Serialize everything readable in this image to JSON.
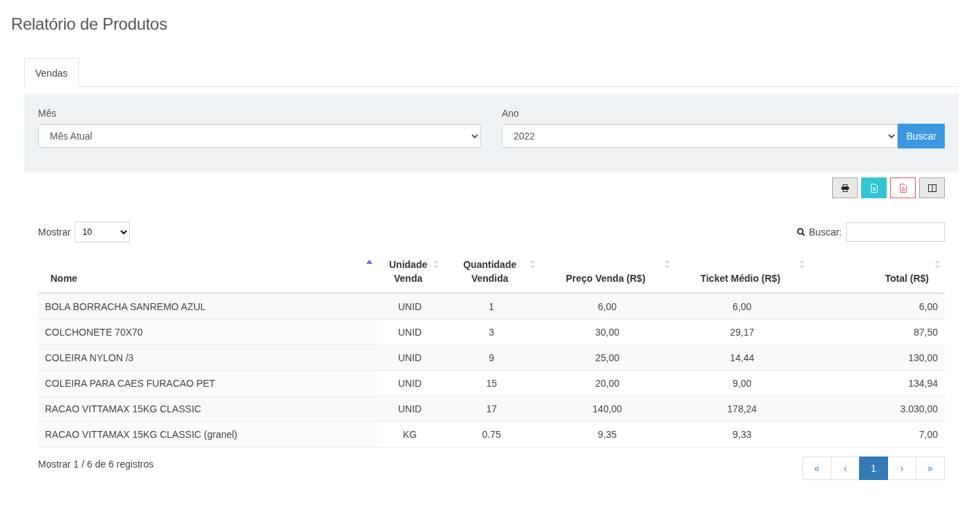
{
  "page_title": "Relatório de Produtos",
  "tabs": [
    {
      "label": "Vendas",
      "selected": true
    }
  ],
  "filters": {
    "month": {
      "label": "Mês",
      "value": "Mês Atual"
    },
    "year": {
      "label": "Ano",
      "value": "2022"
    },
    "search_button": "Buscar"
  },
  "toolbar": [
    {
      "kind": "print"
    },
    {
      "kind": "excel"
    },
    {
      "kind": "pdf"
    },
    {
      "kind": "columns"
    }
  ],
  "length": {
    "label": "Mostrar",
    "value": "10"
  },
  "search": {
    "label": "Buscar:"
  },
  "table": {
    "columns": [
      {
        "label": "Nome",
        "sorted": true
      },
      {
        "label": "Unidade Venda",
        "sorted": false
      },
      {
        "label": "Quantidade Vendida",
        "sorted": false
      },
      {
        "label": "Preço Venda (R$)",
        "sorted": false
      },
      {
        "label": "Ticket Médio (R$)",
        "sorted": false
      },
      {
        "label": "Total (R$)",
        "sorted": false
      }
    ],
    "rows": [
      [
        "BOLA BORRACHA SANREMO AZUL",
        "UNID",
        "1",
        "6,00",
        "6,00",
        "6,00"
      ],
      [
        "COLCHONETE 70X70",
        "UNID",
        "3",
        "30,00",
        "29,17",
        "87,50"
      ],
      [
        "COLEIRA NYLON /3",
        "UNID",
        "9",
        "25,00",
        "14,44",
        "130,00"
      ],
      [
        "COLEIRA PARA CAES FURACAO PET",
        "UNID",
        "15",
        "20,00",
        "9,00",
        "134,94"
      ],
      [
        "RACAO VITTAMAX 15KG CLASSIC",
        "UNID",
        "17",
        "140,00",
        "178,24",
        "3.030,00"
      ],
      [
        "RACAO VITTAMAX 15KG CLASSIC (granel)",
        "KG",
        "0.75",
        "9,35",
        "9,33",
        "7,00"
      ]
    ]
  },
  "info": "Mostrar 1 / 6 de 6 registros",
  "pagination": [
    {
      "label": "«",
      "selected": false
    },
    {
      "label": "‹",
      "selected": false
    },
    {
      "label": "1",
      "selected": true
    },
    {
      "label": "›",
      "selected": false
    },
    {
      "label": "»",
      "selected": false
    }
  ]
}
